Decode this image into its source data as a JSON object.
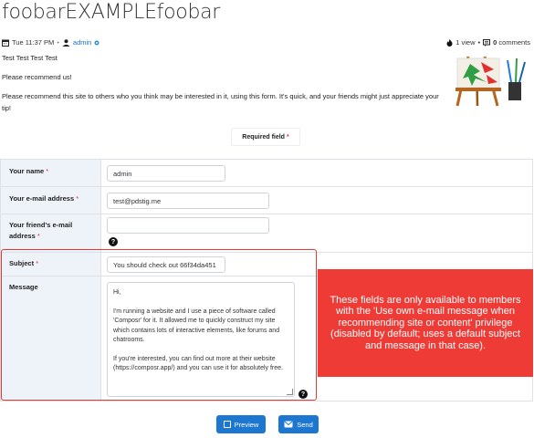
{
  "page": {
    "title": "foobarEXAMPLEfoobar"
  },
  "meta": {
    "date": "Tue 11:37 PM",
    "separator": "•",
    "author": "admin",
    "views": "1 view",
    "comments_count": "0",
    "comments_label": "comments"
  },
  "intro": {
    "line1": "Test Test Test Test",
    "line2": "Please recommend us!",
    "line3a": "Please recommend this site to others who you think may be interested in it, using this form. It's quick, and your friends might just appreciate your",
    "line3b": "tip!"
  },
  "required_note": {
    "label": "Required field",
    "star": "*"
  },
  "form": {
    "name": {
      "label": "Your name",
      "star": "*",
      "value": "admin"
    },
    "email": {
      "label": "Your e-mail address",
      "star": "*",
      "value": "test@pdstig.me"
    },
    "friend_email": {
      "label_line1": "Your friend's e-mail",
      "label_line2": "address",
      "star": "*",
      "value": ""
    },
    "subject": {
      "label": "Subject",
      "star": "*",
      "value": "You should check out 66f34da451"
    },
    "message": {
      "label": "Message",
      "p1": "Hi,",
      "p2": "I'm running a website and I use a piece of software called 'Composr' for it. It allowed me to quickly construct my site which contains lots of interactive elements, like forums and chatrooms.",
      "p3": "If you're interested, you can find out more at their website (https://composr.app/) and you can use it for absolutely free."
    },
    "help_glyph": "?"
  },
  "callout": {
    "text": "These fields are only available to members with the 'Use own e-mail message when recommending site or content' privilege (disabled by default; uses a default subject and message in that case)."
  },
  "buttons": {
    "preview": "Preview",
    "send": "Send"
  },
  "icons": [
    "calendar-icon",
    "user-icon",
    "status-icon",
    "fire-icon",
    "comment-icon",
    "easel-art-icon",
    "help-icon",
    "preview-icon",
    "send-icon"
  ],
  "colors": {
    "accent": "#1d76d0",
    "callout_bg": "#ef3b36",
    "label_bg": "#eef2f9",
    "required": "#dc3545"
  }
}
